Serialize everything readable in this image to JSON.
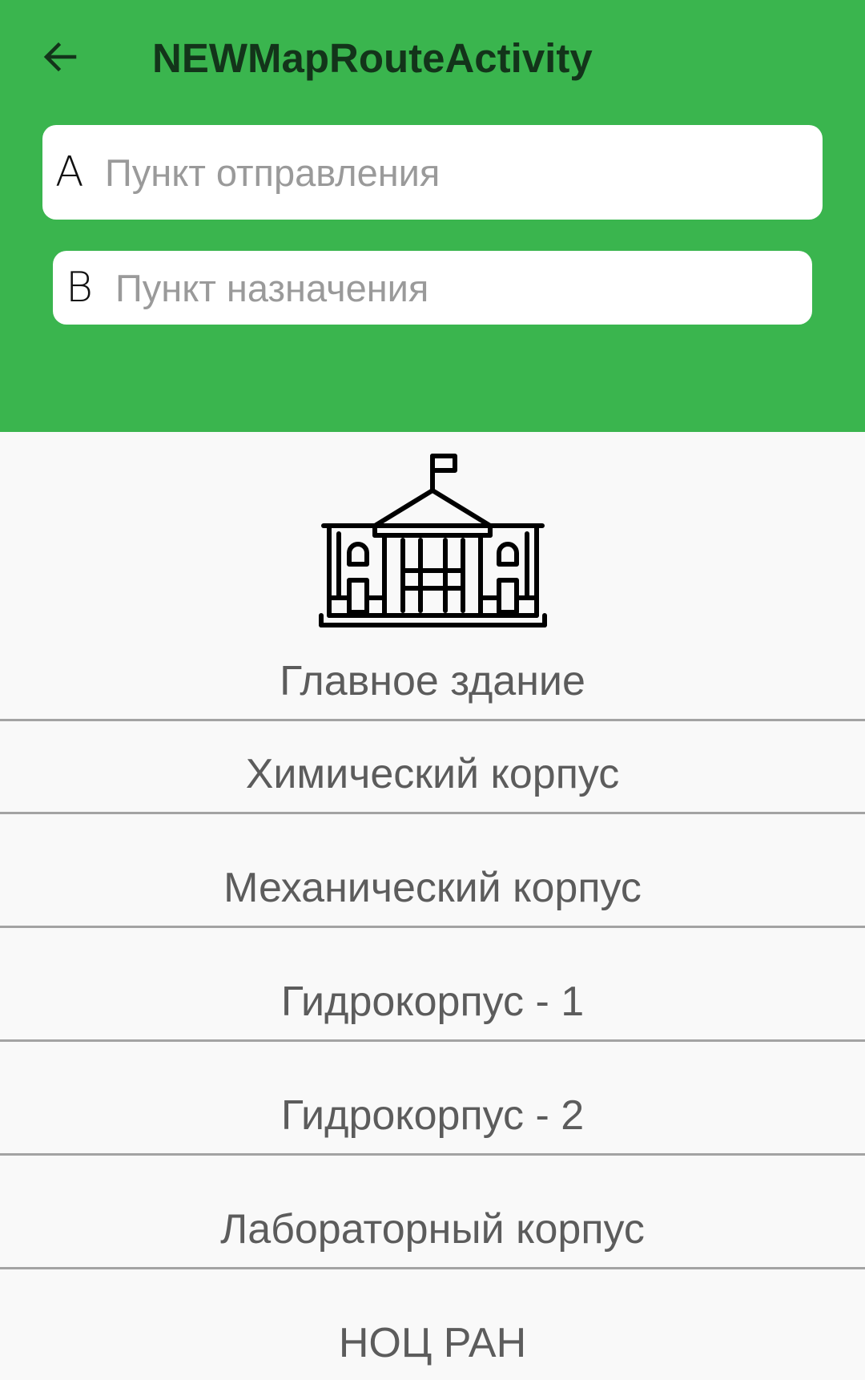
{
  "app_bar": {
    "title": "NEWMapRouteActivity",
    "back_icon": "arrow-back-icon",
    "background_color": "#3ab54e",
    "title_color": "#13341a"
  },
  "route": {
    "origin": {
      "letter": "A",
      "placeholder": "Пункт отправления",
      "value": ""
    },
    "destination": {
      "letter": "B",
      "placeholder": "Пункт назначения",
      "value": ""
    }
  },
  "buildings": {
    "icon": "building-icon",
    "items": [
      {
        "label": "Главное здание"
      },
      {
        "label": "Химический корпус"
      },
      {
        "label": "Механический корпус"
      },
      {
        "label": "Гидрокорпус - 1"
      },
      {
        "label": "Гидрокорпус - 2"
      },
      {
        "label": "Лабораторный корпус"
      },
      {
        "label": "НОЦ РАН"
      }
    ]
  }
}
